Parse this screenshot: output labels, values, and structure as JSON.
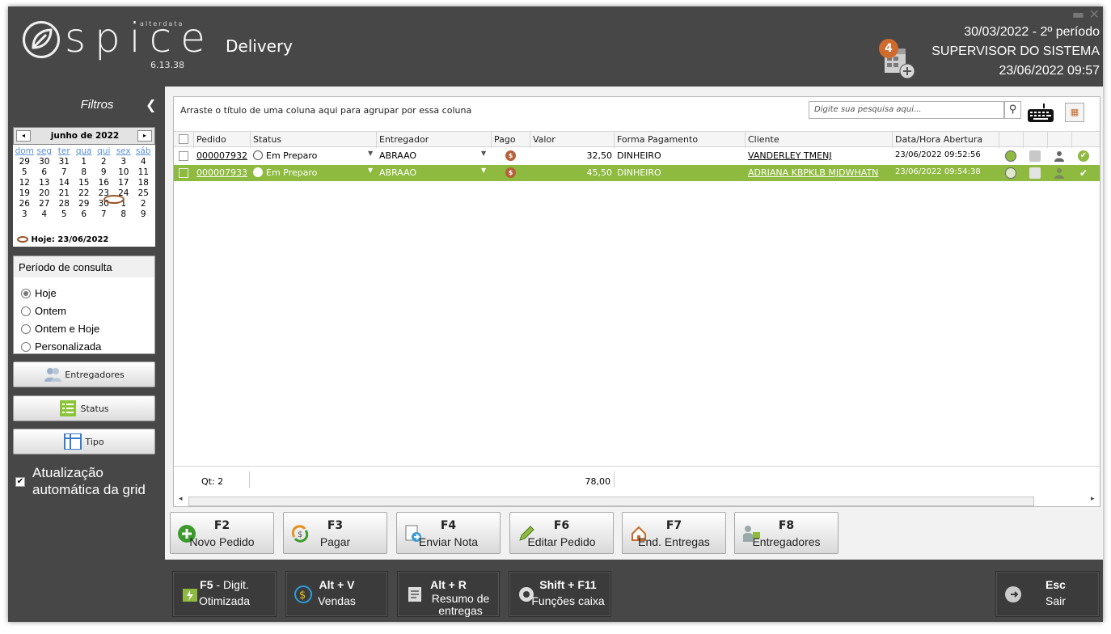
{
  "app": {
    "logo_text": "spice",
    "brand": "alterdata",
    "version": "6.13.38",
    "module": "Delivery"
  },
  "header": {
    "date_period": "30/03/2022 - 2º período",
    "user": "SUPERVISOR DO SISTEMA",
    "datetime": "23/06/2022 09:57",
    "notification_count": "4"
  },
  "sidebar": {
    "title": "Filtros",
    "collapse_icon": "chevron-left",
    "calendar": {
      "month": "junho de 2022",
      "prev": "◂",
      "next": "▸",
      "dows": [
        "dom",
        "seg",
        "ter",
        "qua",
        "qui",
        "sex",
        "sáb"
      ],
      "weeks": [
        [
          "29",
          "30",
          "31",
          "1",
          "2",
          "3",
          "4"
        ],
        [
          "5",
          "6",
          "7",
          "8",
          "9",
          "10",
          "11"
        ],
        [
          "12",
          "13",
          "14",
          "15",
          "16",
          "17",
          "18"
        ],
        [
          "19",
          "20",
          "21",
          "22",
          "23",
          "24",
          "25"
        ],
        [
          "26",
          "27",
          "28",
          "29",
          "30",
          "1",
          "2"
        ],
        [
          "3",
          "4",
          "5",
          "6",
          "7",
          "8",
          "9"
        ]
      ],
      "today_label": "Hoje: 23/06/2022"
    },
    "period": {
      "title": "Período de consulta",
      "options": [
        "Hoje",
        "Ontem",
        "Ontem e Hoje",
        "Personalizada"
      ],
      "selected": "Hoje"
    },
    "buttons": {
      "couriers": "Entregadores",
      "status": "Status",
      "type": "Tipo"
    },
    "auto_update": {
      "line1": "Atualização",
      "line2": "automática da grid",
      "checked": true
    }
  },
  "grid": {
    "group_hint": "Arraste o título de uma coluna aqui para agrupar por essa coluna",
    "search_placeholder": "Digite sua pesquisa aqui...",
    "columns": [
      "Pedido",
      "Status",
      "Entregador",
      "Pago",
      "Valor",
      "Forma Pagamento",
      "Cliente",
      "Data/Hora Abertura"
    ],
    "rows": [
      {
        "order": "000007932",
        "status": "Em Preparo",
        "courier": "ABRAAO",
        "paid": "$",
        "value": "32,50",
        "payment": "DINHEIRO",
        "client": "VANDERLEY TMENJ",
        "opened": "23/06/2022 09:52:56",
        "selected": false
      },
      {
        "order": "000007933",
        "status": "Em Preparo",
        "courier": "ABRAAO",
        "paid": "$",
        "value": "45,50",
        "payment": "DINHEIRO",
        "client": "ADRIANA KBPKLB MJDWHATN",
        "opened": "23/06/2022 09:54:38",
        "selected": true
      }
    ],
    "footer": {
      "count": "Qt: 2",
      "total": "78,00"
    }
  },
  "actions": [
    {
      "key": "F2",
      "label": "Novo Pedido"
    },
    {
      "key": "F3",
      "label": "Pagar"
    },
    {
      "key": "F4",
      "label": "Enviar Nota"
    },
    {
      "key": "F6",
      "label": "Editar Pedido"
    },
    {
      "key": "F7",
      "label": "End. Entregas"
    },
    {
      "key": "F8",
      "label": "Entregadores"
    }
  ],
  "dock": [
    {
      "key": "F5",
      "key_suffix": " - Digit.",
      "label": "Otimizada"
    },
    {
      "key": "Alt + V",
      "label": "Vendas"
    },
    {
      "key": "Alt + R",
      "label": "Resumo de entregas"
    },
    {
      "key": "Shift + F11",
      "label": "Funções caixa"
    },
    {
      "key": "Esc",
      "label": "Sair"
    }
  ],
  "colors": {
    "window_bg": "#474747",
    "selected_row": "#8dba3f",
    "accent_orange": "#cf6b2d",
    "coin": "#b5603b"
  }
}
